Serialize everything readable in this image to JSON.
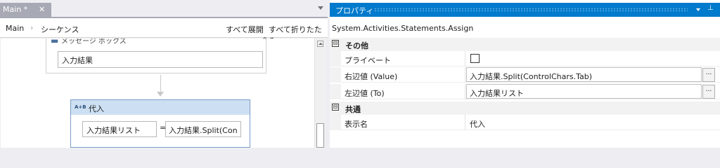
{
  "designer": {
    "tab": {
      "label": "Main *",
      "close": "✕"
    },
    "breadcrumb": {
      "root": "Main",
      "separator": "›",
      "current": "シーケンス"
    },
    "expand_all": "すべて展開",
    "collapse_all": "すべて折りたたみ",
    "message_box": {
      "title": "メッセージ ボックス",
      "text": "入力結果",
      "collapse_icon": "⌃"
    },
    "assign": {
      "icon": "A+B",
      "title": "代入",
      "to": "入力結果リスト",
      "equals": "=",
      "value": "入力結果.Split(Con"
    }
  },
  "properties": {
    "title": "プロパティ",
    "pin": "⊥",
    "type_name": "System.Activities.Statements.Assign",
    "categories": [
      {
        "toggle": "⊟",
        "name": "その他"
      },
      {
        "toggle": "⊟",
        "name": "共通"
      }
    ],
    "rows": {
      "private": {
        "name": "プライベート",
        "checked": false
      },
      "right_value": {
        "name": "右辺値 (Value)",
        "value": "入力結果.Split(ControlChars.Tab)",
        "button": "..."
      },
      "left_value": {
        "name": "左辺値 (To)",
        "value": "入力結果リスト",
        "button": "..."
      },
      "display_name": {
        "name": "表示名",
        "value": "代入"
      }
    }
  },
  "colors": {
    "accent": "#007acc",
    "tab_inactive": "#a7a9b4",
    "assign_header": "#cde0f3"
  }
}
